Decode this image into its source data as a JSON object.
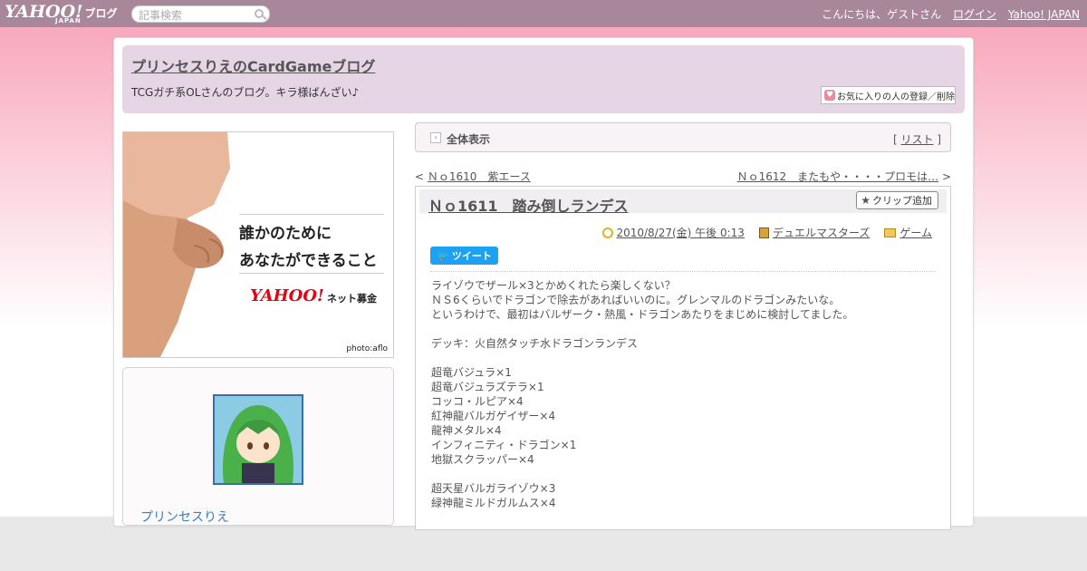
{
  "topbar": {
    "logo": "YAHOO!",
    "logo_sub": "JAPAN",
    "logo_blog": "ブログ",
    "search_placeholder": "記事検索",
    "greeting": "こんにちは、ゲストさん",
    "login": "ログイン",
    "yahoo_link": "Yahoo! JAPAN"
  },
  "header": {
    "title": "プリンセスりえのCardGameブログ",
    "description": "TCGガチ系OLさんのブログ。キラ様ばんざい♪",
    "fav_button": "お気に入りの人の登録／削除"
  },
  "banner": {
    "line1": "誰かのために",
    "line2": "あなたができること",
    "logo": "YAHOO!",
    "logo_sub": "ネット募金",
    "logo_jp": "JAPAN",
    "photo_credit": "photo:aflo"
  },
  "profile": {
    "name": "プリンセスりえ"
  },
  "viewbar": {
    "label": "全体表示",
    "list_open": "[ ",
    "list_link": "リスト",
    "list_close": " ]"
  },
  "nav": {
    "prev_arrow": "< ",
    "prev_label": "Ｎｏ1610　紫エース",
    "next_label": "Ｎｏ1612　またもや・・・・プロモは…",
    "next_arrow": " >"
  },
  "article": {
    "title": "Ｎｏ1611　踏み倒しランデス",
    "clip_button": "クリップ追加",
    "date": "2010/8/27(金) 午後 0:13",
    "category": "デュエルマスターズ",
    "genre": "ゲーム",
    "tweet": "ツイート",
    "body": [
      "ライゾウでザール×3とかめくれたら楽しくない？",
      "ＮＳ6くらいでドラゴンで除去があればいいのに。グレンマルのドラゴンみたいな。",
      "というわけで、最初はバルザーク・熱風・ドラゴンあたりをまじめに検討してました。",
      "",
      "デッキ：火自然タッチ水ドラゴンランデス",
      "",
      "超竜バジュラ×1",
      "超竜バジュラズテラ×1",
      "コッコ・ルピア×4",
      "紅神龍バルガゲイザー×4",
      "龍神メタル×4",
      "インフィニティ・ドラゴン×1",
      "地獄スクラッパー×4",
      "",
      "超天星バルガライゾウ×3",
      "緑神龍ミルドガルムス×4"
    ]
  },
  "colors": {
    "topbar": "#a8879a",
    "header": "#e6d5e4",
    "tweet": "#1da1f2",
    "banner_logo": "#e60012"
  }
}
